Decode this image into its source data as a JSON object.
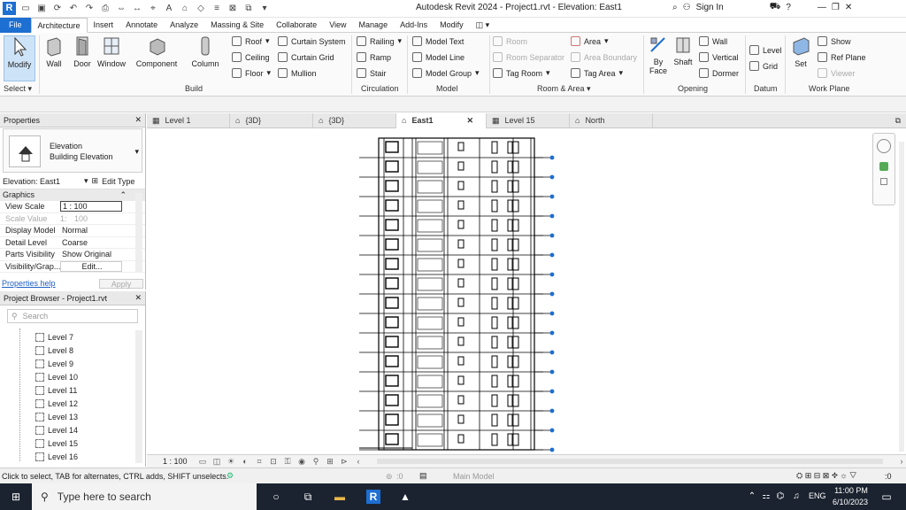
{
  "title_bar": {
    "title": "Autodesk Revit 2024 - Project1.rvt - Elevation: East1",
    "sign_in": "Sign In"
  },
  "menu": {
    "tabs": [
      "File",
      "Architecture",
      "Insert",
      "Annotate",
      "Analyze",
      "Massing & Site",
      "Collaborate",
      "View",
      "Manage",
      "Add-Ins",
      "Modify"
    ]
  },
  "ribbon": {
    "modify": "Modify",
    "select": "Select",
    "wall": "Wall",
    "door": "Door",
    "window": "Window",
    "component": "Component",
    "column": "Column",
    "roof": "Roof",
    "ceiling": "Ceiling",
    "floor": "Floor",
    "curtain_system": "Curtain System",
    "curtain_grid": "Curtain Grid",
    "mullion": "Mullion",
    "build": "Build",
    "railing": "Railing",
    "ramp": "Ramp",
    "stair": "Stair",
    "circulation": "Circulation",
    "model_text": "Model Text",
    "model_line": "Model Line",
    "model_group": "Model Group",
    "model": "Model",
    "room": "Room",
    "room_separator": "Room Separator",
    "tag_room": "Tag Room",
    "area": "Area",
    "area_boundary": "Area Boundary",
    "tag_area": "Tag Area",
    "room_area": "Room & Area",
    "by_face": "By Face",
    "shaft": "Shaft",
    "wall_op": "Wall",
    "vertical": "Vertical",
    "dormer": "Dormer",
    "opening": "Opening",
    "level": "Level",
    "grid": "Grid",
    "datum": "Datum",
    "set": "Set",
    "show": "Show",
    "ref_plane": "Ref Plane",
    "viewer": "Viewer",
    "work_plane": "Work Plane"
  },
  "properties": {
    "header": "Properties",
    "type_line1": "Elevation",
    "type_line2": "Building Elevation",
    "instance": "Elevation: East1",
    "edit_type": "Edit Type",
    "section": "Graphics",
    "rows": [
      {
        "k": "View Scale",
        "v": "1 : 100"
      },
      {
        "k": "Scale Value",
        "v": "100",
        "pre": "1:"
      },
      {
        "k": "Display Model",
        "v": "Normal"
      },
      {
        "k": "Detail Level",
        "v": "Coarse"
      },
      {
        "k": "Parts Visibility",
        "v": "Show Original"
      },
      {
        "k": "Visibility/Grap...",
        "v": "Edit..."
      }
    ],
    "help": "Properties help",
    "apply": "Apply"
  },
  "browser": {
    "header": "Project Browser - Project1.rvt",
    "search_placeholder": "Search",
    "levels": [
      "Level 7",
      "Level 8",
      "Level 9",
      "Level 10",
      "Level 11",
      "Level 12",
      "Level 13",
      "Level 14",
      "Level 15",
      "Level 16"
    ]
  },
  "view_tabs": [
    "Level 1",
    "{3D}",
    "{3D}",
    "East1",
    "Level 15",
    "North"
  ],
  "view_control": {
    "scale": "1 : 100"
  },
  "status": {
    "hint": "Click to select, TAB for alternates, CTRL adds, SHIFT unselects.",
    "zero": ":0",
    "model": "Main Model"
  },
  "taskbar": {
    "search": "Type here to search",
    "lang": "ENG",
    "time": "11:00 PM",
    "date": "6/10/2023"
  }
}
